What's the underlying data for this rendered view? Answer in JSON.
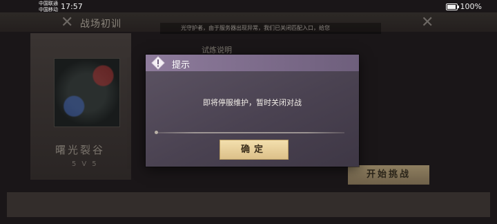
{
  "status_bar": {
    "carrier_1": "中国联通",
    "carrier_2": "中国移动",
    "time": "17:57",
    "battery": "100%"
  },
  "background": {
    "title": "战场初训",
    "notice": "光守护者，由于服务器出现异常，我们已关闭匹配入口，给您",
    "tab_label": "试炼说明",
    "map_name": "曙光裂谷",
    "mode": "5V5",
    "start_button": "开始挑战"
  },
  "dialog": {
    "title": "提示",
    "message": "即将停服维护，暂时关闭对战",
    "confirm_label": "确定"
  },
  "colors": {
    "dialog_header": "#8e7c9c",
    "dialog_body": "#4a4251",
    "confirm_button": "#f3dfad",
    "start_button": "#8f7f60"
  }
}
